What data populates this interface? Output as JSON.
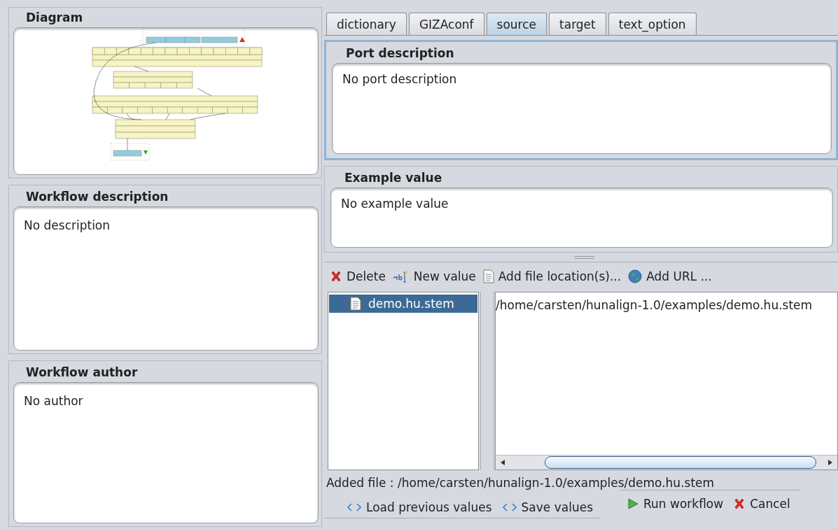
{
  "panels": [
    {
      "kind": "diagram",
      "title": "Diagram"
    },
    {
      "kind": "text",
      "title": "Workflow description",
      "text": "No description"
    },
    {
      "kind": "text",
      "title": "Workflow author",
      "text": "No author"
    }
  ],
  "tabs": [
    {
      "label": "dictionary",
      "selected": false
    },
    {
      "label": "GIZAconf",
      "selected": false
    },
    {
      "label": "source",
      "selected": true
    },
    {
      "label": "target",
      "selected": false
    },
    {
      "label": "text_option",
      "selected": false
    }
  ],
  "port_description": {
    "title": "Port description",
    "text": "No port description",
    "focused": true
  },
  "example_value": {
    "title": "Example value",
    "text": "No example value"
  },
  "toolbar": [
    {
      "kind": "delete",
      "label": "Delete"
    },
    {
      "kind": "new",
      "label": "New value"
    },
    {
      "kind": "file",
      "label": "Add file location(s)..."
    },
    {
      "kind": "url",
      "label": "Add URL ..."
    }
  ],
  "values": [
    {
      "label": "demo.hu.stem",
      "selected": true
    }
  ],
  "value_text": "/home/carsten/hunalign-1.0/examples/demo.hu.stem",
  "status": "Added file : /home/carsten/hunalign-1.0/examples/demo.hu.stem",
  "bottom_left": [
    {
      "kind": "arrows",
      "label": "Load previous values"
    },
    {
      "kind": "arrows",
      "label": "Save values"
    }
  ],
  "bottom_right": [
    {
      "kind": "run",
      "label": "Run workflow"
    },
    {
      "kind": "cancel",
      "label": "Cancel"
    }
  ]
}
